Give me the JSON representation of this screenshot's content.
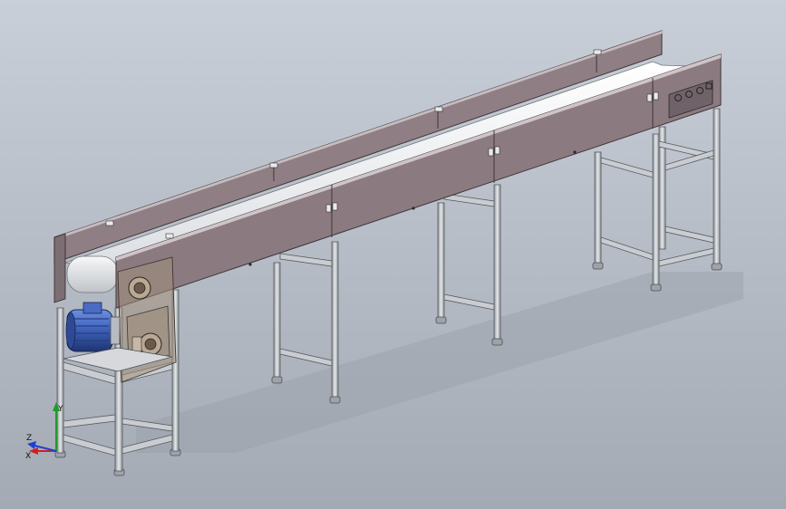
{
  "viewport": {
    "background_top": "#c9cfd8",
    "background_bottom": "#a4aab4"
  },
  "model": {
    "panel_color": "#8b7b80",
    "belt_color": "#f4f5f7",
    "frame_color": "#b8bcc2",
    "motor_color": "#3b5fb8",
    "gearbox_color": "#a3907a"
  },
  "triad": {
    "x_label": "X",
    "y_label": "Y",
    "z_label": "Z",
    "x_color": "#d22020",
    "y_color": "#1f9a2a",
    "z_color": "#2040d0"
  }
}
